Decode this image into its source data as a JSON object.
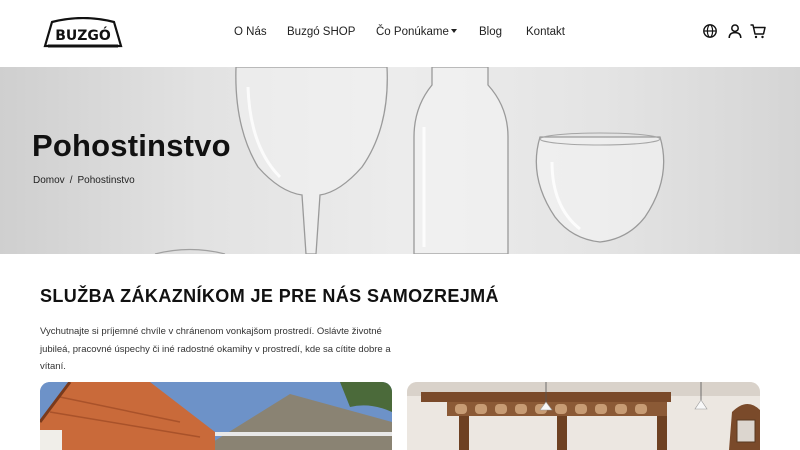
{
  "brand": {
    "logo_text": "BUZGÓ"
  },
  "nav": {
    "items": [
      {
        "label": "O Nás"
      },
      {
        "label": "Buzgó SHOP"
      },
      {
        "label": "Čo Ponúkame"
      },
      {
        "label": "Blog"
      },
      {
        "label": "Kontakt"
      }
    ]
  },
  "header_icons": [
    "globe-icon",
    "user-icon",
    "cart-icon"
  ],
  "hero": {
    "title": "Pohostinstvo",
    "breadcrumb": {
      "home": "Domov",
      "separator": "/",
      "current": "Pohostinstvo"
    }
  },
  "content": {
    "heading": "SLUŽBA ZÁKAZNÍKOM JE PRE NÁS SAMOZREJMÁ",
    "intro": "Vychutnajte si príjemné chvíle v chránenom vonkajšom prostredí. Oslávte životné jubileá, pracovné úspechy či iné radostné okamihy v prostredí, kde sa cítite dobre a vítaní."
  },
  "colors": {
    "text": "#111111",
    "hero_bg": "#e4e4e4",
    "sky": "#6d92c8",
    "roof": "#c96a3a"
  }
}
